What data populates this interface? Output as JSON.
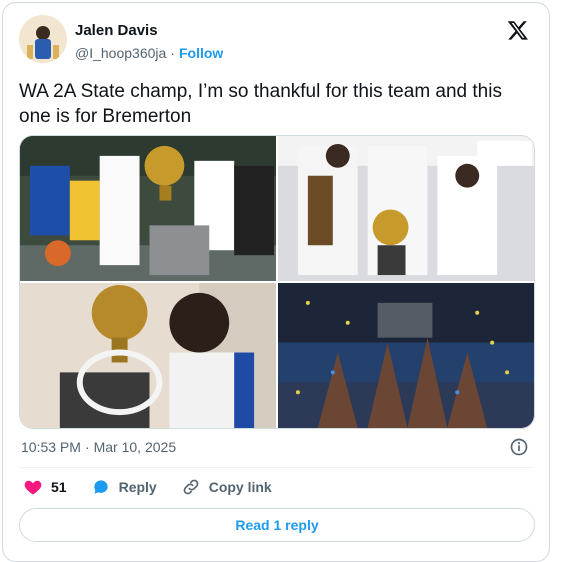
{
  "author": {
    "name": "Jalen Davis",
    "handle": "@I_hoop360ja",
    "separator": "·",
    "follow_label": "Follow"
  },
  "tweet": {
    "text": "WA 2A State champ, I’m so thankful for this team and this one is for Bremerton"
  },
  "media": {
    "count": 4
  },
  "meta": {
    "time": "10:53 PM",
    "separator": "·",
    "date": "Mar 10, 2025"
  },
  "actions": {
    "likes": "51",
    "reply_label": "Reply",
    "copy_link_label": "Copy link"
  },
  "read_replies_label": "Read 1 reply",
  "colors": {
    "accent": "#1d9bf0",
    "like": "#f91880",
    "muted": "#536471"
  },
  "icons": [
    "x-logo-icon",
    "info-icon",
    "heart-icon",
    "reply-bubble-icon",
    "link-icon"
  ]
}
